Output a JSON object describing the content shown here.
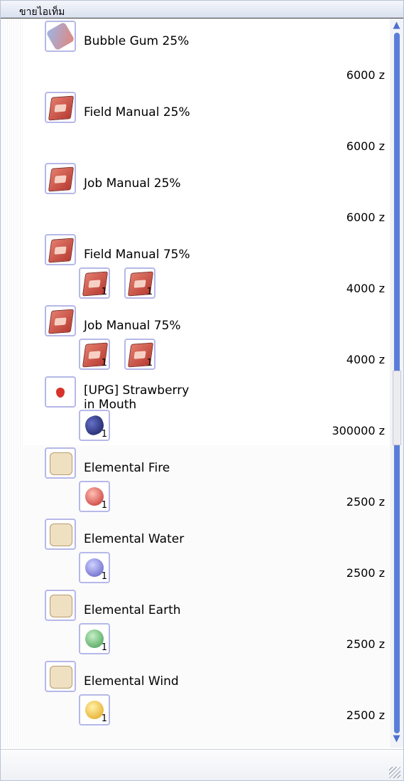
{
  "window": {
    "title": "ขายไอเท็ม"
  },
  "items": [
    {
      "name": "Bubble Gum 25%",
      "price": "6000 z",
      "icon": "bubble-gum-icon",
      "cards": []
    },
    {
      "name": "Field Manual 25%",
      "price": "6000 z",
      "icon": "manual-book-icon",
      "cards": []
    },
    {
      "name": "Job Manual 25%",
      "price": "6000 z",
      "icon": "manual-book-icon",
      "cards": []
    },
    {
      "name": "Field Manual 75%",
      "price": "4000 z",
      "icon": "manual-book-icon",
      "cards": [
        {
          "qty": "1",
          "icon": "manual-book-icon"
        },
        {
          "qty": "1",
          "icon": "manual-book-icon"
        }
      ]
    },
    {
      "name": "Job Manual 75%",
      "price": "4000 z",
      "icon": "manual-book-icon",
      "cards": [
        {
          "qty": "1",
          "icon": "manual-book-icon"
        },
        {
          "qty": "1",
          "icon": "manual-book-icon"
        }
      ]
    },
    {
      "name": "[UPG] Strawberry in Mouth",
      "name_line1": "[UPG] Strawberry",
      "name_line2": "in Mouth",
      "price": "300000 z",
      "icon": "strawberry-icon",
      "cards": [
        {
          "qty": "1",
          "icon": "dark-orb-icon"
        }
      ]
    },
    {
      "name": "Elemental Fire",
      "price": "2500 z",
      "icon": "scroll-icon",
      "cards": [
        {
          "qty": "1",
          "icon": "fire-orb-icon"
        }
      ]
    },
    {
      "name": "Elemental Water",
      "price": "2500 z",
      "icon": "scroll-icon",
      "cards": [
        {
          "qty": "1",
          "icon": "water-orb-icon"
        }
      ]
    },
    {
      "name": "Elemental Earth",
      "price": "2500 z",
      "icon": "scroll-icon",
      "cards": [
        {
          "qty": "1",
          "icon": "earth-orb-icon"
        }
      ]
    },
    {
      "name": "Elemental Wind",
      "price": "2500 z",
      "icon": "scroll-icon",
      "cards": [
        {
          "qty": "1",
          "icon": "wind-orb-icon"
        }
      ]
    }
  ],
  "colors": {
    "scroll_track": "#5a7ed8",
    "slot_border": "#b6b8e8"
  }
}
